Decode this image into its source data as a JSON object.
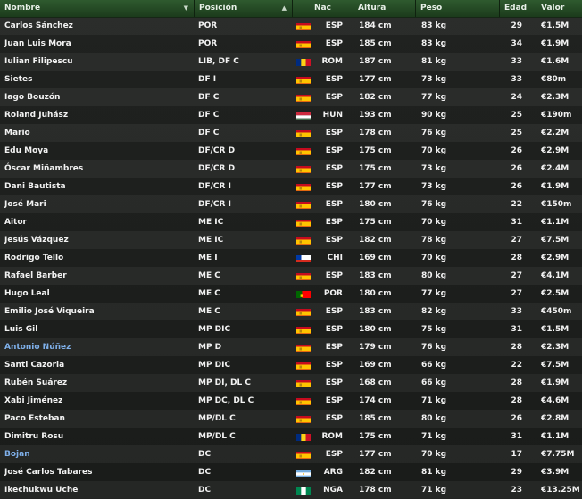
{
  "columns": {
    "nombre": "Nombre",
    "posicion": "Posición",
    "nac": "Nac",
    "altura": "Altura",
    "peso": "Peso",
    "edad": "Edad",
    "valor": "Valor"
  },
  "colors": {
    "header_bg": "#2a502a",
    "highlight_name": "#7fb0ea",
    "text": "#f2f2f2"
  },
  "rows": [
    {
      "name": "Carlos Sánchez",
      "pos": "POR",
      "flag": "esp",
      "nat": "ESP",
      "alt": "184 cm",
      "peso": "83 kg",
      "edad": "29",
      "valor": "€1.5M"
    },
    {
      "name": "Juan Luis Mora",
      "pos": "POR",
      "flag": "esp",
      "nat": "ESP",
      "alt": "185 cm",
      "peso": "83 kg",
      "edad": "34",
      "valor": "€1.9M"
    },
    {
      "name": "Iulian Filipescu",
      "pos": "LIB, DF C",
      "flag": "rom",
      "nat": "ROM",
      "alt": "187 cm",
      "peso": "81 kg",
      "edad": "33",
      "valor": "€1.6M"
    },
    {
      "name": "Sietes",
      "pos": "DF I",
      "flag": "esp",
      "nat": "ESP",
      "alt": "177 cm",
      "peso": "73 kg",
      "edad": "33",
      "valor": "€80m"
    },
    {
      "name": "Iago Bouzón",
      "pos": "DF C",
      "flag": "esp",
      "nat": "ESP",
      "alt": "182 cm",
      "peso": "77 kg",
      "edad": "24",
      "valor": "€2.3M"
    },
    {
      "name": "Roland Juhász",
      "pos": "DF C",
      "flag": "hun",
      "nat": "HUN",
      "alt": "193 cm",
      "peso": "90 kg",
      "edad": "25",
      "valor": "€190m"
    },
    {
      "name": "Mario",
      "pos": "DF C",
      "flag": "esp",
      "nat": "ESP",
      "alt": "178 cm",
      "peso": "76 kg",
      "edad": "25",
      "valor": "€2.2M"
    },
    {
      "name": "Edu Moya",
      "pos": "DF/CR D",
      "flag": "esp",
      "nat": "ESP",
      "alt": "175 cm",
      "peso": "70 kg",
      "edad": "26",
      "valor": "€2.9M"
    },
    {
      "name": "Óscar Miñambres",
      "pos": "DF/CR D",
      "flag": "esp",
      "nat": "ESP",
      "alt": "175 cm",
      "peso": "73 kg",
      "edad": "26",
      "valor": "€2.4M"
    },
    {
      "name": "Dani Bautista",
      "pos": "DF/CR I",
      "flag": "esp",
      "nat": "ESP",
      "alt": "177 cm",
      "peso": "73 kg",
      "edad": "26",
      "valor": "€1.9M"
    },
    {
      "name": "José Mari",
      "pos": "DF/CR I",
      "flag": "esp",
      "nat": "ESP",
      "alt": "180 cm",
      "peso": "76 kg",
      "edad": "22",
      "valor": "€150m"
    },
    {
      "name": "Aitor",
      "pos": "ME IC",
      "flag": "esp",
      "nat": "ESP",
      "alt": "175 cm",
      "peso": "70 kg",
      "edad": "31",
      "valor": "€1.1M"
    },
    {
      "name": "Jesús Vázquez",
      "pos": "ME IC",
      "flag": "esp",
      "nat": "ESP",
      "alt": "182 cm",
      "peso": "78 kg",
      "edad": "27",
      "valor": "€7.5M"
    },
    {
      "name": "Rodrigo Tello",
      "pos": "ME I",
      "flag": "chi",
      "nat": "CHI",
      "alt": "169 cm",
      "peso": "70 kg",
      "edad": "28",
      "valor": "€2.9M"
    },
    {
      "name": "Rafael Barber",
      "pos": "ME C",
      "flag": "esp",
      "nat": "ESP",
      "alt": "183 cm",
      "peso": "80 kg",
      "edad": "27",
      "valor": "€4.1M"
    },
    {
      "name": "Hugo Leal",
      "pos": "ME C",
      "flag": "por",
      "nat": "POR",
      "alt": "180 cm",
      "peso": "77 kg",
      "edad": "27",
      "valor": "€2.5M"
    },
    {
      "name": "Emilio José Viqueira",
      "pos": "ME C",
      "flag": "esp",
      "nat": "ESP",
      "alt": "183 cm",
      "peso": "82 kg",
      "edad": "33",
      "valor": "€450m"
    },
    {
      "name": "Luis Gil",
      "pos": "MP DIC",
      "flag": "esp",
      "nat": "ESP",
      "alt": "180 cm",
      "peso": "75 kg",
      "edad": "31",
      "valor": "€1.5M"
    },
    {
      "name": "Antonio Núñez",
      "pos": "MP D",
      "flag": "esp",
      "nat": "ESP",
      "alt": "179 cm",
      "peso": "76 kg",
      "edad": "28",
      "valor": "€2.3M",
      "highlight": true
    },
    {
      "name": "Santi Cazorla",
      "pos": "MP DIC",
      "flag": "esp",
      "nat": "ESP",
      "alt": "169 cm",
      "peso": "66 kg",
      "edad": "22",
      "valor": "€7.5M"
    },
    {
      "name": "Rubén Suárez",
      "pos": "MP DI, DL C",
      "flag": "esp",
      "nat": "ESP",
      "alt": "168 cm",
      "peso": "66 kg",
      "edad": "28",
      "valor": "€1.9M"
    },
    {
      "name": "Xabi Jiménez",
      "pos": "MP DC, DL C",
      "flag": "esp",
      "nat": "ESP",
      "alt": "174 cm",
      "peso": "71 kg",
      "edad": "28",
      "valor": "€4.6M"
    },
    {
      "name": "Paco Esteban",
      "pos": "MP/DL C",
      "flag": "esp",
      "nat": "ESP",
      "alt": "185 cm",
      "peso": "80 kg",
      "edad": "26",
      "valor": "€2.8M"
    },
    {
      "name": "Dimitru Rosu",
      "pos": "MP/DL C",
      "flag": "rom",
      "nat": "ROM",
      "alt": "175 cm",
      "peso": "71 kg",
      "edad": "31",
      "valor": "€1.1M"
    },
    {
      "name": "Bojan",
      "pos": "DC",
      "flag": "esp",
      "nat": "ESP",
      "alt": "177 cm",
      "peso": "70 kg",
      "edad": "17",
      "valor": "€7.75M",
      "highlight": true
    },
    {
      "name": "José Carlos Tabares",
      "pos": "DC",
      "flag": "arg",
      "nat": "ARG",
      "alt": "182 cm",
      "peso": "81 kg",
      "edad": "29",
      "valor": "€3.9M"
    },
    {
      "name": "Ikechukwu Uche",
      "pos": "DC",
      "flag": "nga",
      "nat": "NGA",
      "alt": "178 cm",
      "peso": "71 kg",
      "edad": "23",
      "valor": "€13.25M"
    }
  ]
}
